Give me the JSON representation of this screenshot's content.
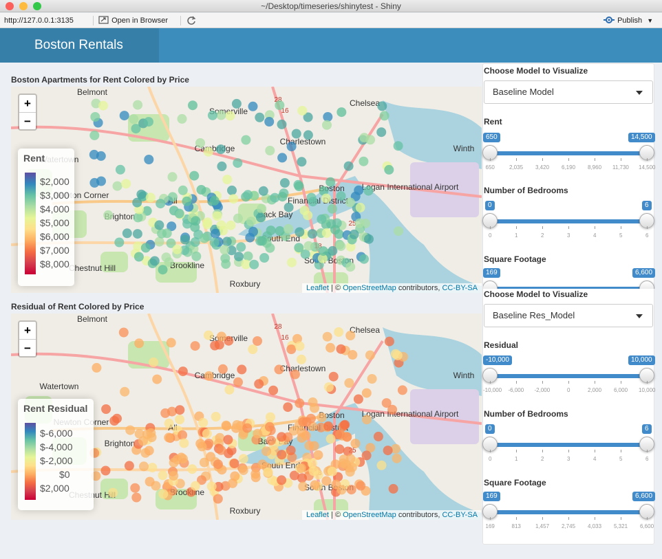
{
  "window": {
    "title": "~/Desktop/timeseries/shinytest - Shiny"
  },
  "toolbar": {
    "url": "http://127.0.0.1:3135",
    "open_browser": "Open in Browser",
    "publish": "Publish"
  },
  "app": {
    "brand": "Boston Rentals"
  },
  "map_labels": [
    {
      "text": "Belmont"
    },
    {
      "text": "Somerville"
    },
    {
      "text": "Chelsea"
    },
    {
      "text": "Cambridge"
    },
    {
      "text": "Charlestown"
    },
    {
      "text": "Watertown"
    },
    {
      "text": "Winth"
    },
    {
      "text": "Boston"
    },
    {
      "text": "Financial District"
    },
    {
      "text": "Logan International Airport"
    },
    {
      "text": "Newton Corner"
    },
    {
      "text": "Brighton"
    },
    {
      "text": "All"
    },
    {
      "text": "Back Bay"
    },
    {
      "text": "South End"
    },
    {
      "text": "Chestnut Hill"
    },
    {
      "text": "Brookline"
    },
    {
      "text": "South Boston"
    },
    {
      "text": "Roxbury"
    },
    {
      "text": "28"
    },
    {
      "text": "16"
    },
    {
      "text": "25"
    },
    {
      "text": "18"
    }
  ],
  "map1": {
    "title": "Boston Apartments for Rent Colored by Price",
    "zoom_in": "+",
    "zoom_out": "−",
    "legend_title": "Rent",
    "legend_labels": [
      "$2,000",
      "$3,000",
      "$4,000",
      "$5,000",
      "$6,000",
      "$7,000",
      "$8,000"
    ],
    "attrib_leaflet": "Leaflet",
    "attrib_osm": "OpenStreetMap",
    "attrib_contrib": "contributors,",
    "attrib_cc": "CC-BY-SA"
  },
  "map2": {
    "title": "Residual of Rent Colored by Price",
    "zoom_in": "+",
    "zoom_out": "−",
    "legend_title": "Rent Residual",
    "legend_labels": [
      "$-6,000",
      "$-4,000",
      "$-2,000",
      "$0",
      "$2,000"
    ],
    "attrib_leaflet": "Leaflet",
    "attrib_osm": "OpenStreetMap",
    "attrib_contrib": "contributors,",
    "attrib_cc": "CC-BY-SA"
  },
  "panel": {
    "model1_label": "Choose Model to Visualize",
    "model1_value": "Baseline Model",
    "rent": {
      "label": "Rent",
      "min_val": "650",
      "max_val": "14,500",
      "ticks": [
        "650",
        "2,035",
        "3,420",
        "6,190",
        "8,960",
        "11,730",
        "14,500"
      ]
    },
    "beds1": {
      "label": "Number of Bedrooms",
      "min_val": "0",
      "max_val": "6",
      "ticks": [
        "0",
        "1",
        "2",
        "3",
        "4",
        "5",
        "6"
      ]
    },
    "sqft1": {
      "label": "Square Footage",
      "min_val": "169",
      "max_val": "6,600"
    },
    "model2_label": "Choose Model to Visualize",
    "model2_value": "Baseline Res_Model",
    "resid": {
      "label": "Residual",
      "min_val": "-10,000",
      "max_val": "10,000",
      "ticks": [
        "-10,000",
        "-6,000",
        "-2,000",
        "0",
        "2,000",
        "6,000",
        "10,000"
      ]
    },
    "beds2": {
      "label": "Number of Bedrooms",
      "min_val": "0",
      "max_val": "6",
      "ticks": [
        "0",
        "1",
        "2",
        "3",
        "4",
        "5",
        "6"
      ]
    },
    "sqft2": {
      "label": "Square Footage",
      "min_val": "169",
      "max_val": "6,600",
      "ticks": [
        "169",
        "813",
        "1,457",
        "2,745",
        "4,033",
        "5,321",
        "6,600"
      ]
    }
  },
  "colors": {
    "navbar": "#3c8dbc",
    "brand_bg": "#367fa9",
    "slider": "#428bca"
  }
}
